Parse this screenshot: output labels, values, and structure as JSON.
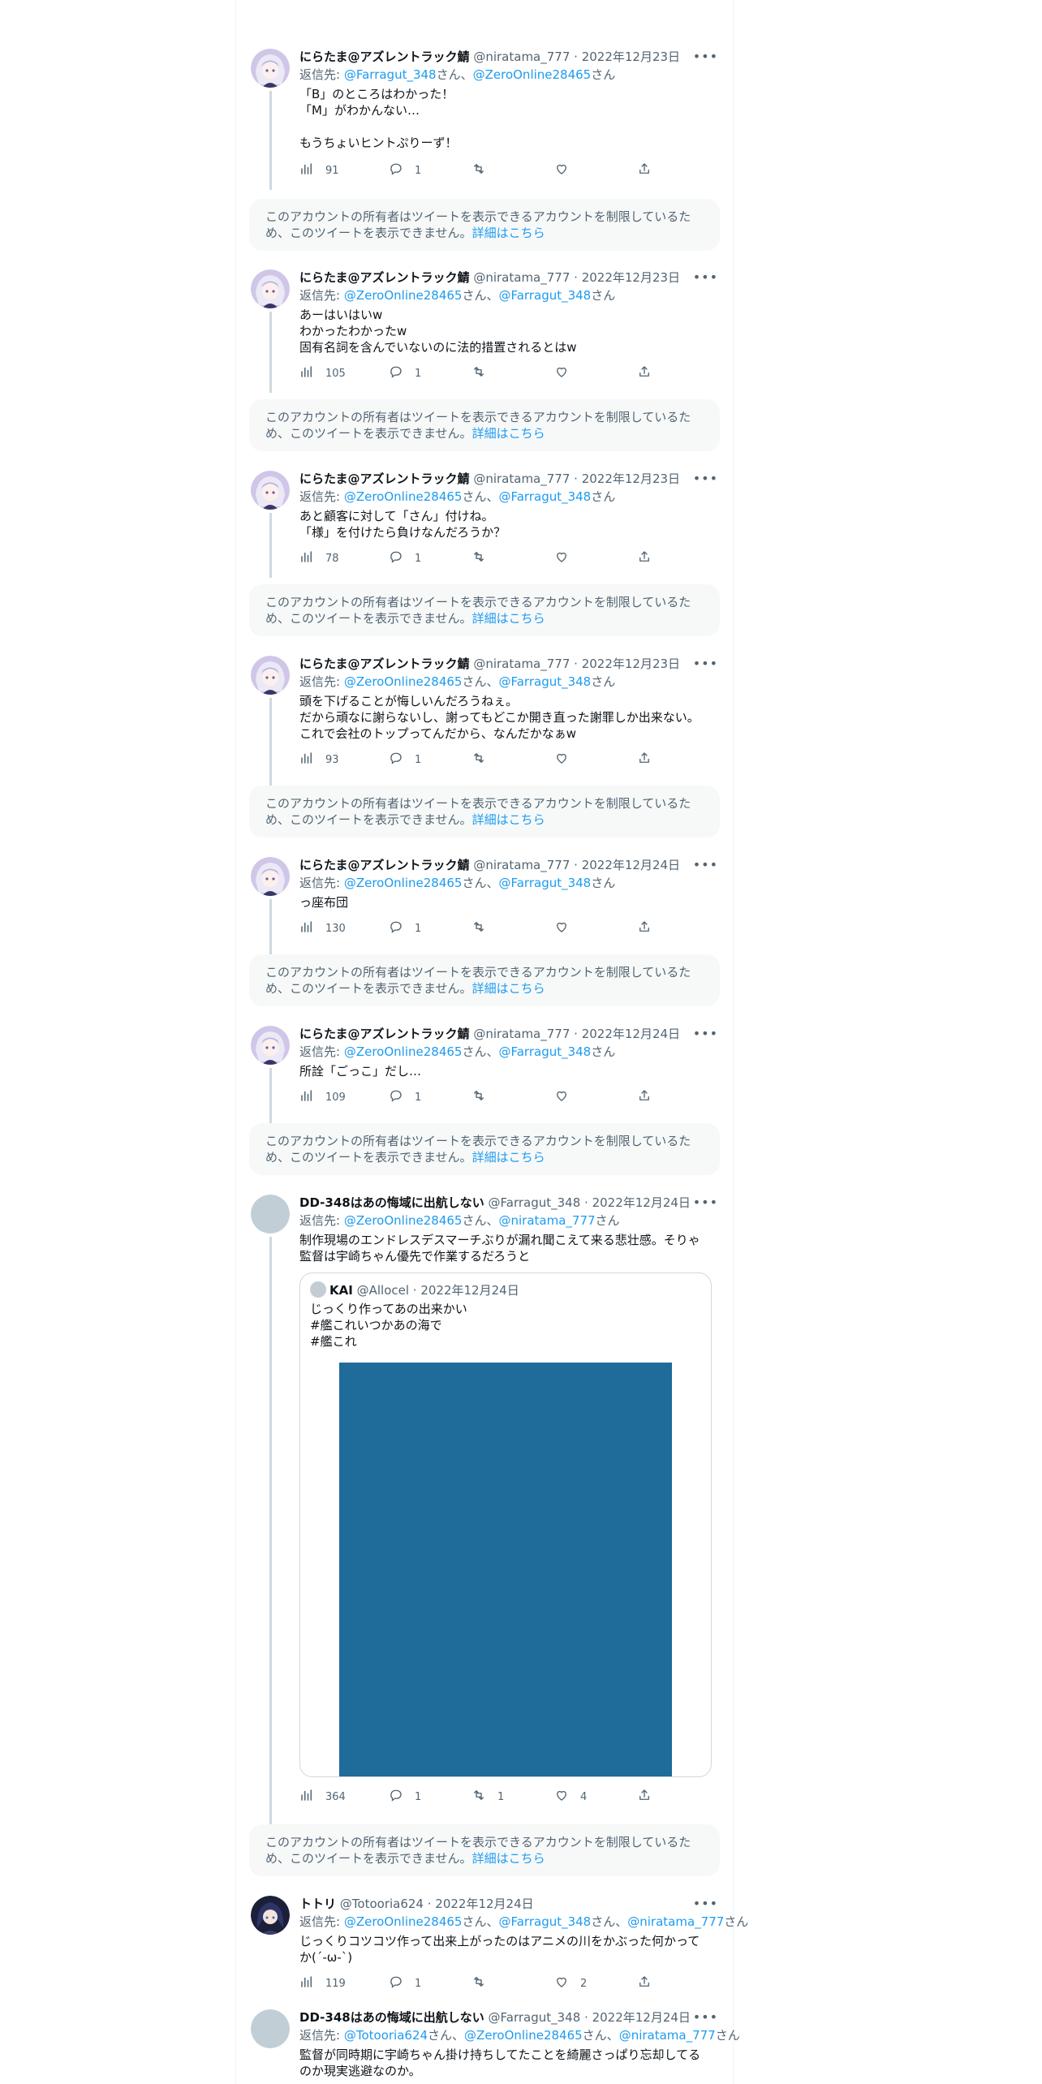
{
  "notice": {
    "text": "このアカウントの所有者はツイートを表示できるアカウントを制限しているため、このツイートを表示できません。",
    "link": "詳細はこちら"
  },
  "tweets": [
    {
      "name": "にらたま@アズレントラック鯖",
      "handle": "@niratama_777",
      "date": "2022年12月23日",
      "reply_label": "返信先:",
      "reply": [
        {
          "text": "@Farragut_348",
          "suffix": "さん、"
        },
        {
          "text": "@ZeroOnline28465",
          "suffix": "さん"
        }
      ],
      "text": "「B」のところはわかった！\n「M」がわかんない…\n\nもうちょいヒントぷりーず！",
      "views": "91",
      "replies": "1",
      "retweets": "",
      "likes": ""
    },
    {
      "name": "にらたま@アズレントラック鯖",
      "handle": "@niratama_777",
      "date": "2022年12月23日",
      "reply_label": "返信先:",
      "reply": [
        {
          "text": "@ZeroOnline28465",
          "suffix": "さん、"
        },
        {
          "text": "@Farragut_348",
          "suffix": "さん"
        }
      ],
      "text": "あーはいはいw\nわかったわかったw\n固有名詞を含んでいないのに法的措置されるとはw",
      "views": "105",
      "replies": "1",
      "retweets": "",
      "likes": ""
    },
    {
      "name": "にらたま@アズレントラック鯖",
      "handle": "@niratama_777",
      "date": "2022年12月23日",
      "reply_label": "返信先:",
      "reply": [
        {
          "text": "@ZeroOnline28465",
          "suffix": "さん、"
        },
        {
          "text": "@Farragut_348",
          "suffix": "さん"
        }
      ],
      "text": "あと顧客に対して「さん」付けね。\n「様」を付けたら負けなんだろうか？",
      "views": "78",
      "replies": "1",
      "retweets": "",
      "likes": ""
    },
    {
      "name": "にらたま@アズレントラック鯖",
      "handle": "@niratama_777",
      "date": "2022年12月23日",
      "reply_label": "返信先:",
      "reply": [
        {
          "text": "@ZeroOnline28465",
          "suffix": "さん、"
        },
        {
          "text": "@Farragut_348",
          "suffix": "さん"
        }
      ],
      "text": "頭を下げることが悔しいんだろうねぇ。\nだから頑なに謝らないし、謝ってもどこか開き直った謝罪しか出来ない。\nこれで会社のトップってんだから、なんだかなぁw",
      "views": "93",
      "replies": "1",
      "retweets": "",
      "likes": ""
    },
    {
      "name": "にらたま@アズレントラック鯖",
      "handle": "@niratama_777",
      "date": "2022年12月24日",
      "reply_label": "返信先:",
      "reply": [
        {
          "text": "@ZeroOnline28465",
          "suffix": "さん、"
        },
        {
          "text": "@Farragut_348",
          "suffix": "さん"
        }
      ],
      "text": "っ座布団",
      "views": "130",
      "replies": "1",
      "retweets": "",
      "likes": ""
    },
    {
      "name": "にらたま@アズレントラック鯖",
      "handle": "@niratama_777",
      "date": "2022年12月24日",
      "reply_label": "返信先:",
      "reply": [
        {
          "text": "@ZeroOnline28465",
          "suffix": "さん、"
        },
        {
          "text": "@Farragut_348",
          "suffix": "さん"
        }
      ],
      "text": "所詮「ごっこ」だし…",
      "views": "109",
      "replies": "1",
      "retweets": "",
      "likes": ""
    },
    {
      "name": "DD-348はあの悔域に出航しない",
      "handle": "@Farragut_348",
      "date": "2022年12月24日",
      "reply_label": "返信先:",
      "reply": [
        {
          "text": "@ZeroOnline28465",
          "suffix": "さん、"
        },
        {
          "text": "@niratama_777",
          "suffix": "さん"
        }
      ],
      "text": "制作現場のエンドレスデスマーチぶりが漏れ聞こえて来る悲壮感。そりゃ\n監督は宇崎ちゃん優先で作業するだろうと",
      "views": "364",
      "replies": "1",
      "retweets": "1",
      "likes": "4",
      "quote": {
        "name": "KAI",
        "handle": "@Allocel",
        "date": "2022年12月24日",
        "text": "じっくり作ってあの出来かい\n#艦これいつかあの海で\n#艦これ"
      }
    },
    {
      "name": "トトリ",
      "handle": "@Totooria624",
      "date": "2022年12月24日",
      "reply_label": "返信先:",
      "reply": [
        {
          "text": "@ZeroOnline28465",
          "suffix": "さん、"
        },
        {
          "text": "@Farragut_348",
          "suffix": "さん、"
        },
        {
          "text": "@niratama_777",
          "suffix": "さん"
        }
      ],
      "text": "じっくりコツコツ作って出来上がったのはアニメの川をかぶった何かって\nか(´-ω-`)",
      "views": "119",
      "replies": "1",
      "retweets": "",
      "likes": "2"
    },
    {
      "name": "DD-348はあの悔域に出航しない",
      "handle": "@Farragut_348",
      "date": "2022年12月24日",
      "reply_label": "返信先:",
      "reply": [
        {
          "text": "@Totooria624",
          "suffix": "さん、"
        },
        {
          "text": "@ZeroOnline28465",
          "suffix": "さん、"
        },
        {
          "text": "@niratama_777",
          "suffix": "さん"
        }
      ],
      "text": "監督が同時期に宇崎ちゃん掛け持ちしてたことを綺麗さっぱり忘却してる\nのか現実逃避なのか。",
      "views": "",
      "replies": "",
      "retweets": "",
      "likes": ""
    }
  ],
  "icons": [
    "views-icon",
    "reply-icon",
    "retweet-icon",
    "like-icon",
    "share-icon",
    "more-icon"
  ],
  "colors": {
    "link": "#1d9bf0",
    "muted": "#536471",
    "thread": "#cfd9de",
    "notice_bg": "#f7f9f9",
    "media": "#1f6b99"
  }
}
